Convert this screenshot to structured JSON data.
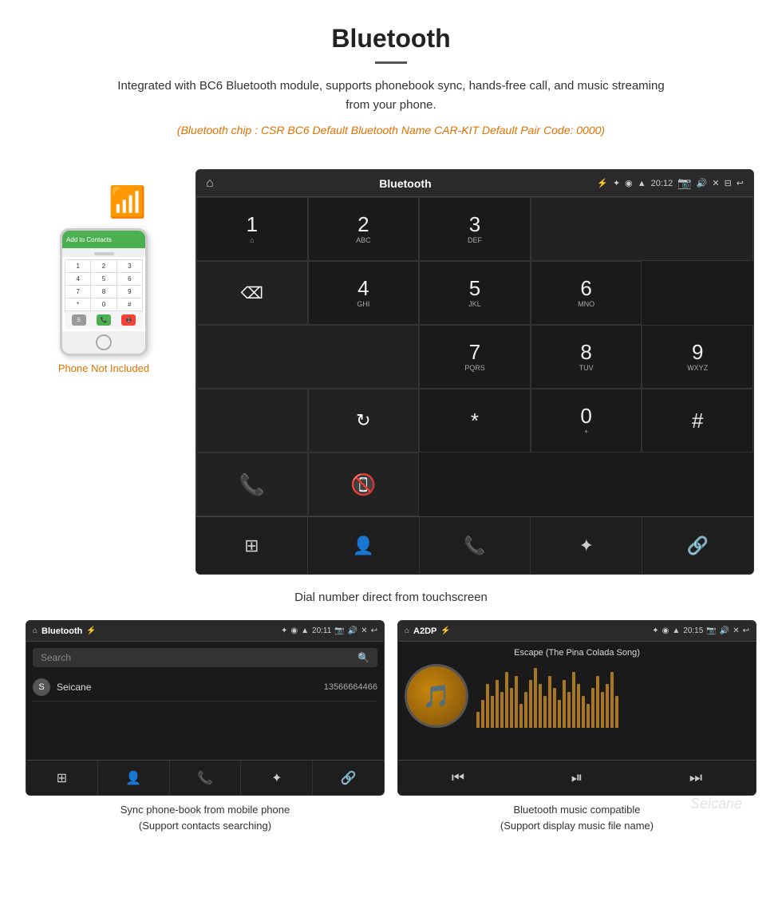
{
  "header": {
    "title": "Bluetooth",
    "description": "Integrated with BC6 Bluetooth module, supports phonebook sync, hands-free call, and music streaming from your phone.",
    "specs": "(Bluetooth chip : CSR BC6    Default Bluetooth Name CAR-KIT    Default Pair Code: 0000)"
  },
  "phone_label": "Phone Not Included",
  "dial_screen": {
    "title": "Bluetooth",
    "time": "20:12",
    "keys": [
      {
        "num": "1",
        "sub": "⌂"
      },
      {
        "num": "2",
        "sub": "ABC"
      },
      {
        "num": "3",
        "sub": "DEF"
      },
      {
        "num": "*"
      },
      {
        "num": "0",
        "sub": "+"
      },
      {
        "num": "#"
      }
    ],
    "caption": "Dial number direct from touchscreen"
  },
  "phonebook_screen": {
    "title": "Bluetooth",
    "time": "20:11",
    "search_placeholder": "Search",
    "contact_name": "Seicane",
    "contact_number": "13566664466",
    "caption_line1": "Sync phone-book from mobile phone",
    "caption_line2": "(Support contacts searching)"
  },
  "music_screen": {
    "title": "A2DP",
    "time": "20:15",
    "song_title": "Escape (The Pina Colada Song)",
    "caption_line1": "Bluetooth music compatible",
    "caption_line2": "(Support display music file name)"
  },
  "viz_bars": [
    20,
    35,
    55,
    40,
    60,
    45,
    70,
    50,
    65,
    30,
    45,
    60,
    75,
    55,
    40,
    65,
    50,
    35,
    60,
    45,
    70,
    55,
    40,
    30,
    50,
    65,
    45,
    55,
    70,
    40
  ]
}
